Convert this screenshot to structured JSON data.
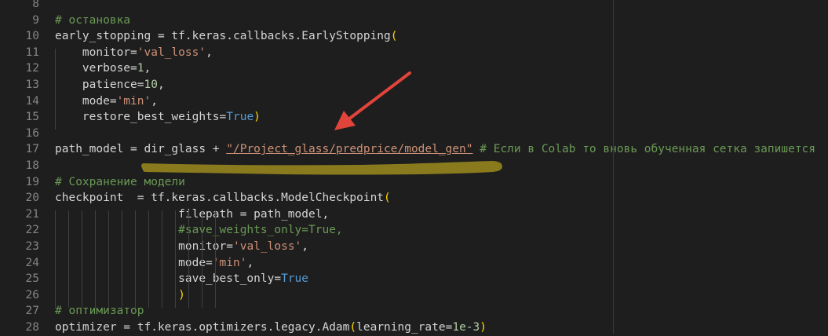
{
  "editor": {
    "lines": [
      {
        "n": "8",
        "parts": []
      },
      {
        "n": "9",
        "parts": [
          {
            "t": "# остановка",
            "c": "comment"
          }
        ]
      },
      {
        "n": "10",
        "parts": [
          {
            "t": "early_stopping = tf.keras.callbacks.EarlyStopping",
            "c": "plain"
          },
          {
            "t": "(",
            "c": "bracket"
          }
        ]
      },
      {
        "n": "11",
        "parts": [
          {
            "t": "    monitor=",
            "c": "plain"
          },
          {
            "t": "'val_loss'",
            "c": "string"
          },
          {
            "t": ",",
            "c": "plain"
          }
        ]
      },
      {
        "n": "12",
        "parts": [
          {
            "t": "    verbose=",
            "c": "plain"
          },
          {
            "t": "1",
            "c": "number"
          },
          {
            "t": ",",
            "c": "plain"
          }
        ]
      },
      {
        "n": "13",
        "parts": [
          {
            "t": "    patience=",
            "c": "plain"
          },
          {
            "t": "10",
            "c": "number"
          },
          {
            "t": ",",
            "c": "plain"
          }
        ]
      },
      {
        "n": "14",
        "parts": [
          {
            "t": "    mode=",
            "c": "plain"
          },
          {
            "t": "'min'",
            "c": "string"
          },
          {
            "t": ",",
            "c": "plain"
          }
        ]
      },
      {
        "n": "15",
        "parts": [
          {
            "t": "    restore_best_weights=",
            "c": "plain"
          },
          {
            "t": "True",
            "c": "keyword"
          },
          {
            "t": ")",
            "c": "bracket"
          }
        ]
      },
      {
        "n": "16",
        "parts": []
      },
      {
        "n": "17",
        "parts": [
          {
            "t": "path_model = dir_glass + ",
            "c": "plain"
          },
          {
            "t": "\"/Project_glass/predprice/model_gen\"",
            "c": "string"
          },
          {
            "t": " # Если в Colab то вновь обученная сетка запишется",
            "c": "comment"
          }
        ]
      },
      {
        "n": "18",
        "parts": []
      },
      {
        "n": "19",
        "parts": [
          {
            "t": "# Сохранение модели",
            "c": "comment"
          }
        ]
      },
      {
        "n": "20",
        "parts": [
          {
            "t": "checkpoint  = tf.keras.callbacks.ModelCheckpoint",
            "c": "plain"
          },
          {
            "t": "(",
            "c": "bracket"
          }
        ]
      },
      {
        "n": "21",
        "parts": [
          {
            "t": "                  filepath = path_model,",
            "c": "plain"
          }
        ]
      },
      {
        "n": "22",
        "parts": [
          {
            "t": "                  #save_weights_only=True,",
            "c": "comment"
          }
        ]
      },
      {
        "n": "23",
        "parts": [
          {
            "t": "                  monitor=",
            "c": "plain"
          },
          {
            "t": "'val_loss'",
            "c": "string"
          },
          {
            "t": ",",
            "c": "plain"
          }
        ]
      },
      {
        "n": "24",
        "parts": [
          {
            "t": "                  mode=",
            "c": "plain"
          },
          {
            "t": "'min'",
            "c": "string"
          },
          {
            "t": ",",
            "c": "plain"
          }
        ]
      },
      {
        "n": "25",
        "parts": [
          {
            "t": "                  save_best_only=",
            "c": "plain"
          },
          {
            "t": "True",
            "c": "keyword"
          }
        ]
      },
      {
        "n": "26",
        "parts": [
          {
            "t": "                  )",
            "c": "bracket"
          }
        ]
      },
      {
        "n": "27",
        "parts": [
          {
            "t": "# оптимизатор",
            "c": "comment"
          }
        ]
      },
      {
        "n": "28",
        "parts": [
          {
            "t": "optimizer = tf.keras.optimizers.legacy.Adam",
            "c": "plain"
          },
          {
            "t": "(",
            "c": "bracket"
          },
          {
            "t": "learning_rate=",
            "c": "plain"
          },
          {
            "t": "1e-3",
            "c": "number"
          },
          {
            "t": ")",
            "c": "bracket"
          }
        ]
      }
    ]
  },
  "annotations": {
    "arrow_color": "#e0443a",
    "underline_color": "#8a7a1e"
  }
}
